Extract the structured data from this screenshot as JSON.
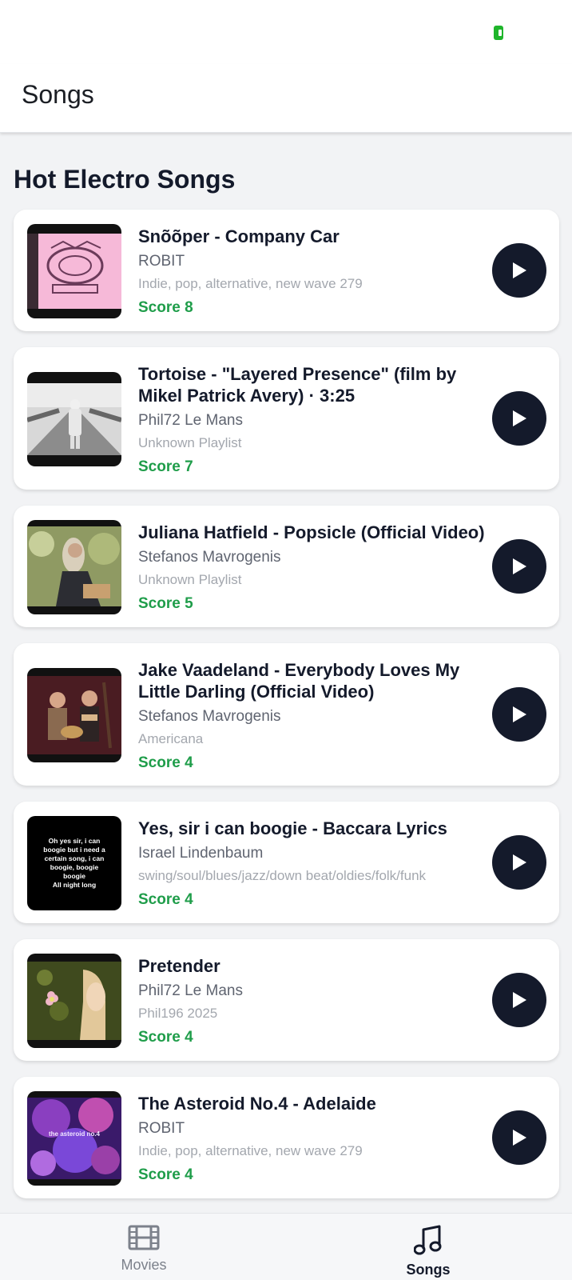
{
  "header": {
    "title": "Songs"
  },
  "section": {
    "title": "Hot Electro Songs"
  },
  "songs": [
    {
      "title": " Snõõper - Company Car",
      "artist": "ROBIT",
      "playlist": "Indie, pop, alternative, new wave 279",
      "score": "Score 8",
      "thumb_icon": "pink-album-art"
    },
    {
      "title": "Tortoise - \"Layered Presence\" (film by Mikel Patrick Avery) · 3:25",
      "artist": "Phil72 Le Mans",
      "playlist": "Unknown Playlist",
      "score": "Score 7",
      "thumb_icon": "road-photo"
    },
    {
      "title": "Juliana Hatfield - Popsicle (Official Video)",
      "artist": "Stefanos Mavrogenis",
      "playlist": "Unknown Playlist",
      "score": "Score 5",
      "thumb_icon": "woman-photo"
    },
    {
      "title": "Jake Vaadeland - Everybody Loves My Little Darling (Official Video)",
      "artist": "Stefanos Mavrogenis",
      "playlist": "Americana",
      "score": "Score 4",
      "thumb_icon": "band-photo"
    },
    {
      "title": "Yes, sir i can boogie - Baccara Lyrics",
      "artist": "Israel Lindenbaum",
      "playlist": "swing/soul/blues/jazz/down beat/oldies/folk/funk",
      "score": "Score 4",
      "thumb_icon": "lyrics-card",
      "thumb_text": [
        "Oh yes sir, i can",
        "boogie but i need a",
        "certain song, i can",
        "boogie, boogie",
        "boogie",
        "All night long"
      ]
    },
    {
      "title": "Pretender",
      "artist": "Phil72 Le Mans",
      "playlist": "Phil196 2025",
      "score": "Score 4",
      "thumb_icon": "flower-photo"
    },
    {
      "title": "The Asteroid No.4 - Adelaide",
      "artist": "ROBIT",
      "playlist": "Indie, pop, alternative, new wave 279",
      "score": "Score 4",
      "thumb_icon": "purple-album-art",
      "thumb_text": [
        "the asteroid no.4"
      ]
    }
  ],
  "nav": {
    "movies_label": "Movies",
    "songs_label": "Songs"
  },
  "colors": {
    "accent": "#141a2b",
    "score": "#1f9d4a",
    "battery": "#1fb52b"
  }
}
